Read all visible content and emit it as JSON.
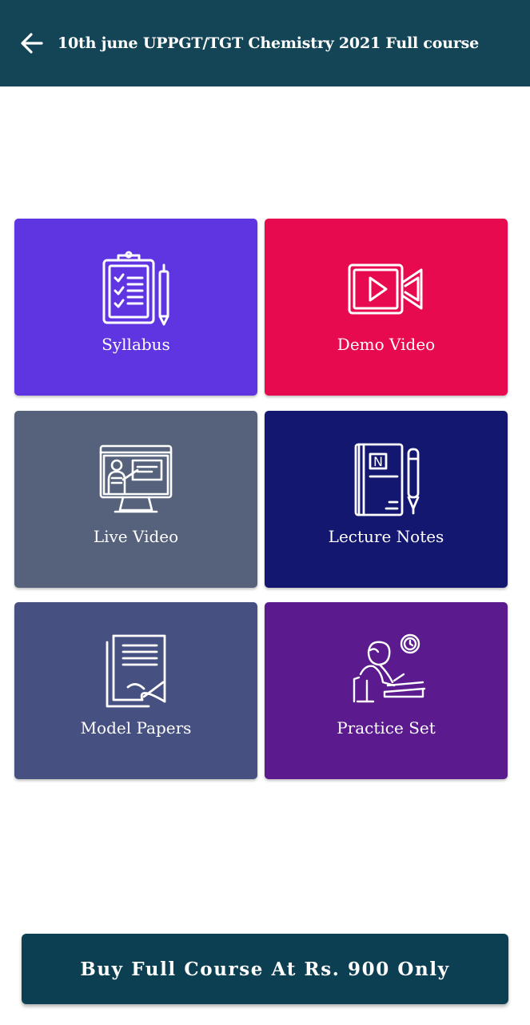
{
  "header": {
    "title": "10th june UPPGT/TGT Chemistry 2021 Full course",
    "back_icon": "arrow-left-icon",
    "background": "#134556"
  },
  "tiles": [
    {
      "label": "Syllabus",
      "icon": "clipboard-checklist-icon",
      "color": "#5e35e0"
    },
    {
      "label": "Demo Video",
      "icon": "video-camera-icon",
      "color": "#e80a4f"
    },
    {
      "label": "Live Video",
      "icon": "monitor-teacher-icon",
      "color": "#56627c"
    },
    {
      "label": "Lecture Notes",
      "icon": "notebook-pen-icon",
      "color": "#14176f"
    },
    {
      "label": "Model Papers",
      "icon": "papers-icon",
      "color": "#475181"
    },
    {
      "label": "Practice Set",
      "icon": "student-writing-icon",
      "color": "#5b1a8e"
    }
  ],
  "buy_button": {
    "label": "Buy Full Course At Rs. 900 Only",
    "color": "#0d3f52"
  }
}
